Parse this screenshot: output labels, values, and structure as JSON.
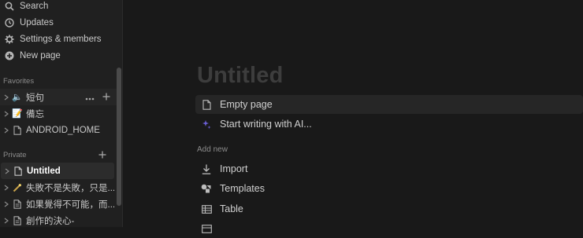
{
  "sidebar": {
    "nav": [
      {
        "label": "Search",
        "icon": "search-icon"
      },
      {
        "label": "Updates",
        "icon": "clock-icon"
      },
      {
        "label": "Settings & members",
        "icon": "gear-icon"
      },
      {
        "label": "New page",
        "icon": "plus-circle-icon"
      }
    ],
    "favorites_title": "Favorites",
    "favorites": [
      {
        "label": "短句",
        "icon": "speaker-emoji-icon",
        "emoji": "🔈"
      },
      {
        "label": "備忘",
        "icon": "memo-emoji-icon",
        "emoji": "📝"
      },
      {
        "label": "ANDROID_HOME",
        "icon": "page-icon"
      }
    ],
    "private_title": "Private",
    "private": [
      {
        "label": "Untitled",
        "icon": "page-icon"
      },
      {
        "label": "失敗不是失敗，只是...",
        "icon": "wand-emoji-icon",
        "emoji": "🪄"
      },
      {
        "label": "如果覺得不可能，而...",
        "icon": "page-icon"
      },
      {
        "label": "創作的決心-",
        "icon": "page-icon"
      }
    ]
  },
  "main": {
    "title": "Untitled",
    "options": [
      {
        "label": "Empty page",
        "icon": "page-icon"
      },
      {
        "label": "Start writing with AI...",
        "icon": "sparkle-icon"
      }
    ],
    "add_new_label": "Add new",
    "add_new": [
      {
        "label": "Import",
        "icon": "download-icon"
      },
      {
        "label": "Templates",
        "icon": "shapes-icon"
      },
      {
        "label": "Table",
        "icon": "table-icon"
      }
    ]
  },
  "colors": {
    "background": "#191919",
    "sidebar": "#202020",
    "ai_accent": "#6b5fd6"
  }
}
